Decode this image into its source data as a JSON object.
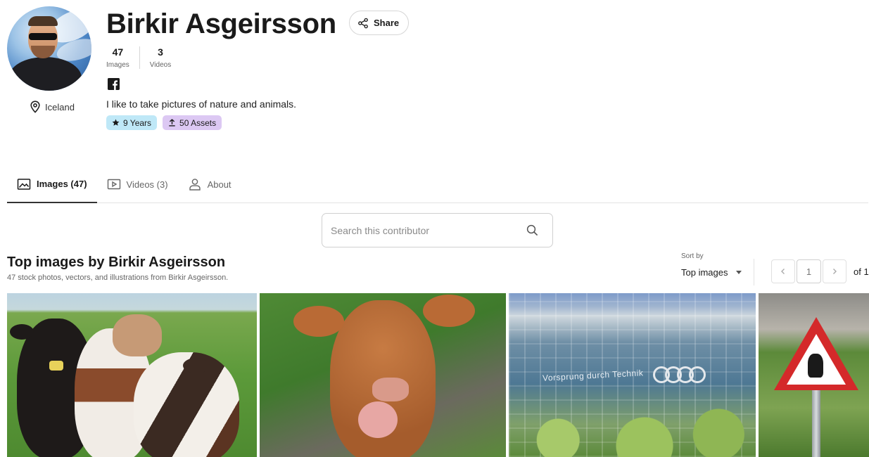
{
  "profile": {
    "name": "Birkir Asgeirsson",
    "share_label": "Share",
    "location": "Iceland",
    "bio": "I like to take pictures of nature and animals.",
    "stats": [
      {
        "value": "47",
        "label": "Images"
      },
      {
        "value": "3",
        "label": "Videos"
      }
    ],
    "social": [
      "facebook-icon"
    ],
    "badges": {
      "years": "9 Years",
      "assets": "50 Assets"
    },
    "colors": {
      "years_badge": "#bfe8f7",
      "assets_badge": "#dcc8f3"
    }
  },
  "tabs": [
    {
      "label": "Images (47)",
      "icon": "image-icon",
      "active": true
    },
    {
      "label": "Videos (3)",
      "icon": "video-icon",
      "active": false
    },
    {
      "label": "About",
      "icon": "user-icon",
      "active": false
    }
  ],
  "search": {
    "placeholder": "Search this contributor",
    "value": ""
  },
  "results": {
    "title": "Top images by Birkir Asgeirsson",
    "subtitle": "47 stock photos, vectors, and illustrations from Birkir Asgeirsson.",
    "sort_label": "Sort by",
    "sort_value": "Top images",
    "page": "1",
    "page_of": "of 1"
  },
  "images": [
    {
      "subject": "cows"
    },
    {
      "subject": "cow"
    },
    {
      "subject": "audi-building",
      "text": "Vorsprung durch Technik"
    },
    {
      "subject": "troll-sign"
    }
  ]
}
